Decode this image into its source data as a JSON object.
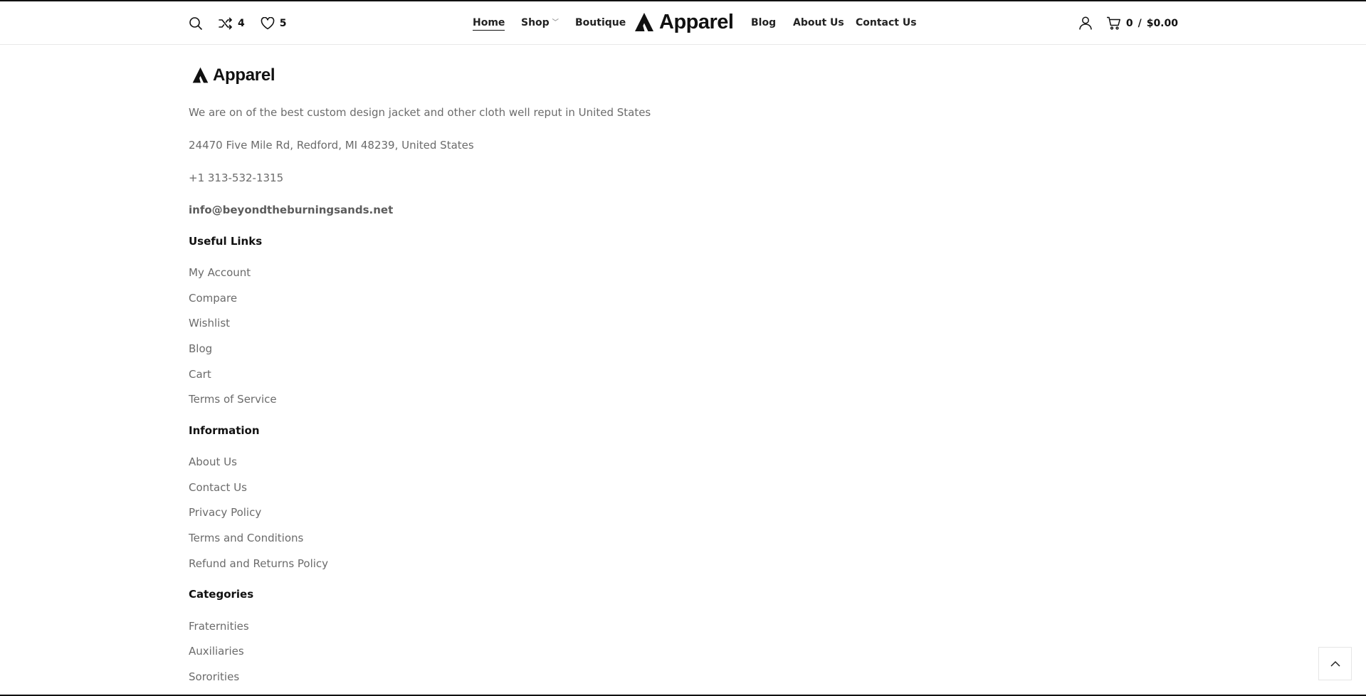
{
  "header": {
    "compare_count": "4",
    "wishlist_count": "5",
    "nav": {
      "home": "Home",
      "shop": "Shop",
      "boutique": "Boutique",
      "blog": "Blog",
      "about": "About Us",
      "contact": "Contact Us"
    },
    "brand": "Apparel",
    "cart_count": "0",
    "cart_separator": "/",
    "cart_total": "$0.00"
  },
  "footer": {
    "brand": "Apparel",
    "tagline": "We are on of the best custom design jacket and other cloth well reput in United States",
    "address": "24470 Five Mile Rd, Redford, MI 48239, United States",
    "phone": "+1 313-532-1315",
    "email": "info@beyondtheburningsands.net",
    "useful_links": {
      "title": "Useful Links",
      "items": [
        "My Account",
        "Compare",
        "Wishlist",
        "Blog",
        "Cart",
        "Terms of Service"
      ]
    },
    "information": {
      "title": "Information",
      "items": [
        "About Us",
        "Contact Us",
        "Privacy Policy",
        "Terms and Conditions",
        "Refund and Returns Policy"
      ]
    },
    "categories": {
      "title": "Categories",
      "items": [
        "Fraternities",
        "Auxiliaries",
        "Sororities"
      ]
    }
  },
  "icons": {
    "search": "search-icon",
    "compare": "shuffle-icon",
    "wishlist": "heart-icon",
    "account": "user-icon",
    "cart": "cart-icon",
    "back_to_top": "chevron-up-icon"
  },
  "colors": {
    "text": "#111111",
    "muted": "#6b6b6b",
    "border": "#e9e9e9"
  }
}
